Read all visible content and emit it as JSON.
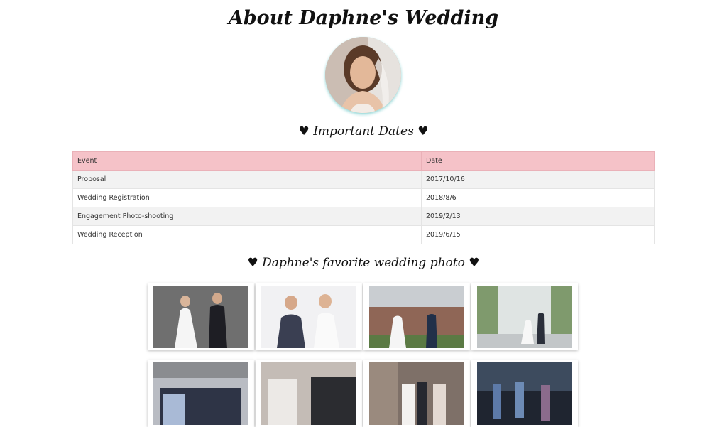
{
  "page": {
    "title": "About Daphne's Wedding"
  },
  "dates_section": {
    "heading": "♥ Important Dates ♥",
    "columns": [
      "Event",
      "Date"
    ],
    "rows": [
      {
        "event": "Proposal",
        "date": "2017/10/16"
      },
      {
        "event": "Wedding Registration",
        "date": "2018/8/6"
      },
      {
        "event": "Engagement Photo-shooting",
        "date": "2019/2/13"
      },
      {
        "event": "Wedding Reception",
        "date": "2019/6/15"
      }
    ]
  },
  "photos_section": {
    "heading": "♥ Daphne's favorite wedding photo ♥"
  },
  "colors": {
    "table_header_bg": "#f5c2c8",
    "row_alt_bg": "#f2f2f2",
    "avatar_glow": "#8fd6d6"
  }
}
